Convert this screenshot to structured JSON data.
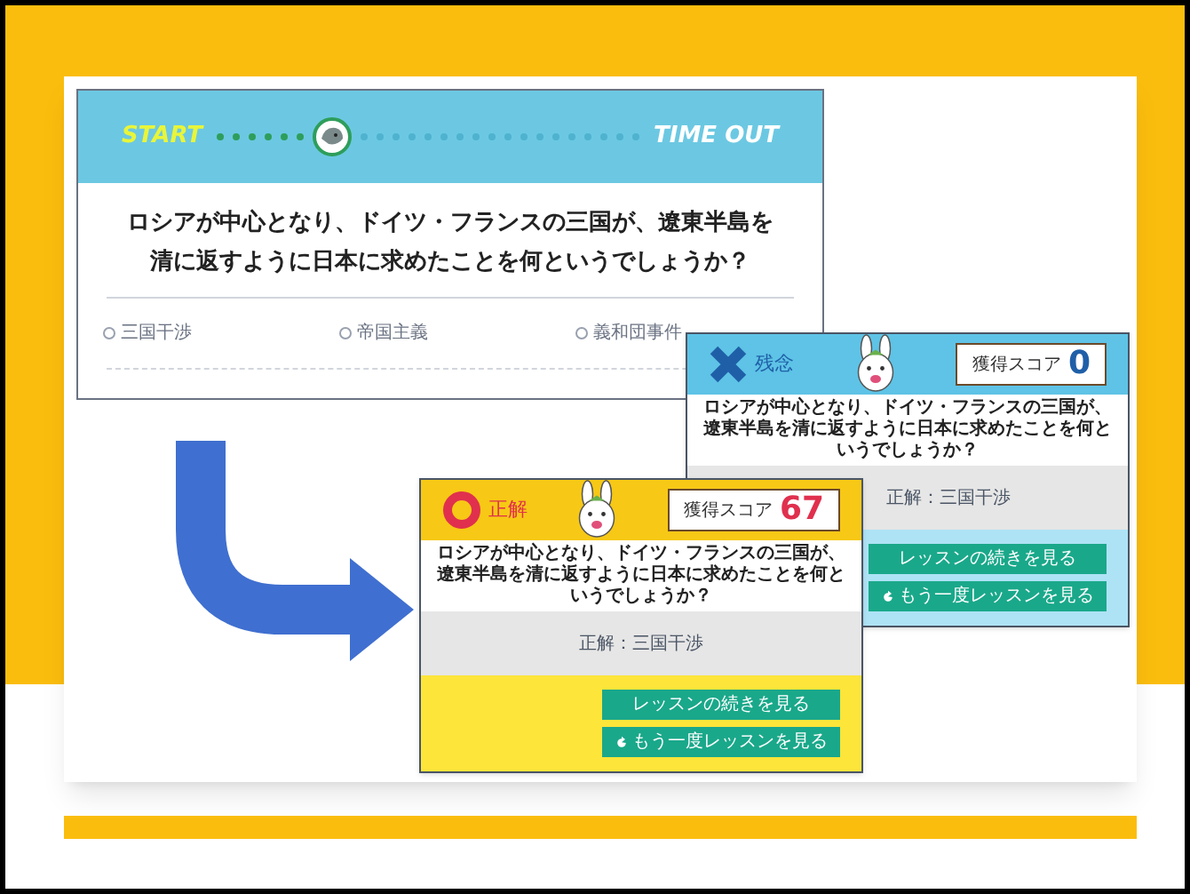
{
  "quiz_screen": {
    "start_label": "START",
    "end_label": "TIME OUT",
    "progress": {
      "level": 0.27
    },
    "question": "ロシアが中心となり、ドイツ・フランスの三国が、遼東半島を清に返すように日本に求めたことを何というでしょうか？",
    "choices": [
      {
        "label": "三国干渉",
        "selected": false
      },
      {
        "label": "帝国主義",
        "selected": false
      },
      {
        "label": "義和団事件",
        "selected": false
      }
    ]
  },
  "result_screens": [
    {
      "kind": "incorrect",
      "status": "残念",
      "score_label": "獲得スコア",
      "score": "0",
      "question": "ロシアが中心となり、ドイツ・フランスの三国が、遼東半島を清に返すように日本に求めたことを何というでしょうか？",
      "answer": "正解：三国干渉",
      "buttons": [
        {
          "label": "レッスンの続きを見る",
          "kind": "plain"
        },
        {
          "label": "もう一度レッスンを見る",
          "kind": "replay"
        }
      ]
    },
    {
      "kind": "correct",
      "status": "正解",
      "score_label": "獲得スコア",
      "score": "67",
      "question": "ロシアが中心となり、ドイツ・フランスの三国が、遼東半島を清に返すように日本に求めたことを何というでしょうか？",
      "answer": "正解：三国干渉",
      "buttons": [
        {
          "label": "レッスンの続きを見る",
          "kind": "plain"
        },
        {
          "label": "もう一度レッスンを見る",
          "kind": "replay"
        }
      ]
    }
  ]
}
